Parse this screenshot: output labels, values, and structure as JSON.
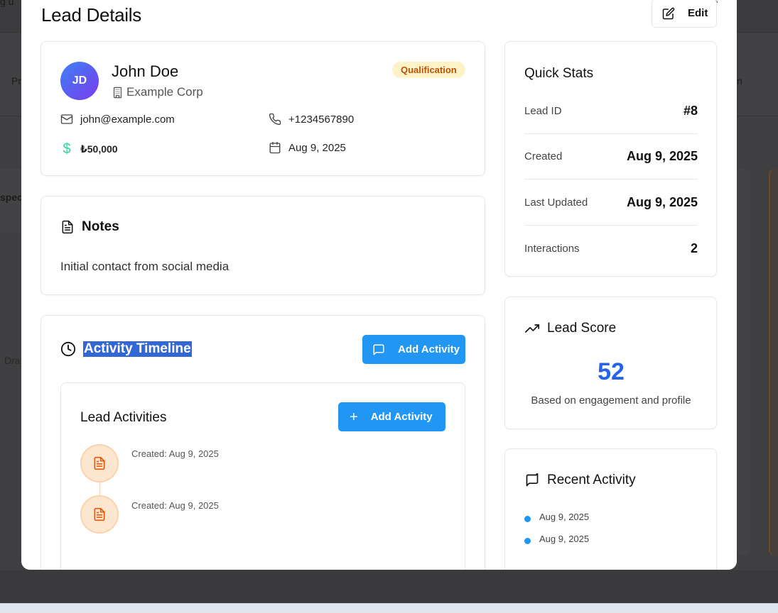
{
  "modal": {
    "title": "Lead Details",
    "edit_label": "Edit",
    "close_glyph": "×"
  },
  "lead": {
    "initials": "JD",
    "name": "John Doe",
    "company": "Example Corp",
    "stage": "Qualification",
    "email": "john@example.com",
    "phone": "+1234567890",
    "value": "₺50,000",
    "date": "Aug 9, 2025"
  },
  "notes": {
    "title": "Notes",
    "text": "Initial contact from social media"
  },
  "timeline": {
    "title": "Activity Timeline",
    "add_label": "Add Activity",
    "activities_title": "Lead Activities",
    "activities_add_label": "Add Activity",
    "items": [
      {
        "label": "Created: Aug 9, 2025"
      },
      {
        "label": "Created: Aug 9, 2025"
      }
    ]
  },
  "quick_stats": {
    "title": "Quick Stats",
    "rows": [
      {
        "label": "Lead ID",
        "value": "#8"
      },
      {
        "label": "Created",
        "value": "Aug 9, 2025"
      },
      {
        "label": "Last Updated",
        "value": "Aug 9, 2025"
      },
      {
        "label": "Interactions",
        "value": "2"
      }
    ]
  },
  "lead_score": {
    "title": "Lead Score",
    "value": "52",
    "caption": "Based on engagement and profile"
  },
  "recent_activity": {
    "title": "Recent Activity",
    "items": [
      "Aug 9, 2025",
      "Aug 9, 2025"
    ]
  },
  "background": {
    "frag_top": "g u",
    "frag_pr": "Pr",
    "frag_n": "n",
    "frag_spec": "spec",
    "frag_dra": "Dra"
  },
  "colors": {
    "accent": "#2196f3",
    "score": "#2563eb",
    "badge_bg": "#fef3c7",
    "badge_text": "#b45309",
    "activity_icon": "#ea580c",
    "dollar": "#34d399"
  }
}
